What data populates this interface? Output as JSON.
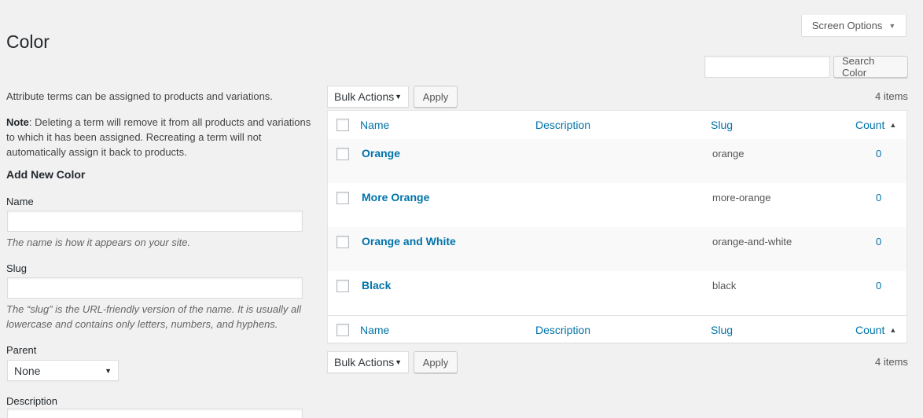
{
  "screen_options": {
    "label": "Screen Options"
  },
  "page_title": "Color",
  "search": {
    "button_label": "Search Color",
    "value": ""
  },
  "left": {
    "intro": "Attribute terms can be assigned to products and variations.",
    "note_label": "Note",
    "note_text": ": Deleting a term will remove it from all products and variations to which it has been assigned. Recreating a term will not automatically assign it back to products.",
    "add_title": "Add New Color",
    "name_label": "Name",
    "name_help": "The name is how it appears on your site.",
    "slug_label": "Slug",
    "slug_help": "The “slug” is the URL-friendly version of the name. It is usually all lowercase and contains only letters, numbers, and hyphens.",
    "parent_label": "Parent",
    "parent_selected": "None",
    "description_label": "Description"
  },
  "bulk": {
    "top_label": "Bulk Actions",
    "bottom_label": "Bulk Actions",
    "apply_top": "Apply",
    "apply_bottom": "Apply",
    "items_top": "4 items",
    "items_bottom": "4 items"
  },
  "table": {
    "columns": {
      "name": "Name",
      "description": "Description",
      "slug": "Slug",
      "count": "Count"
    },
    "rows": [
      {
        "name": "Orange",
        "description": "",
        "slug": "orange",
        "count": "0"
      },
      {
        "name": "More Orange",
        "description": "",
        "slug": "more-orange",
        "count": "0"
      },
      {
        "name": "Orange and White",
        "description": "",
        "slug": "orange-and-white",
        "count": "0"
      },
      {
        "name": "Black",
        "description": "",
        "slug": "black",
        "count": "0"
      }
    ]
  },
  "colors": {
    "link": "#0073aa",
    "background": "#f1f1f1",
    "text": "#23282d"
  }
}
